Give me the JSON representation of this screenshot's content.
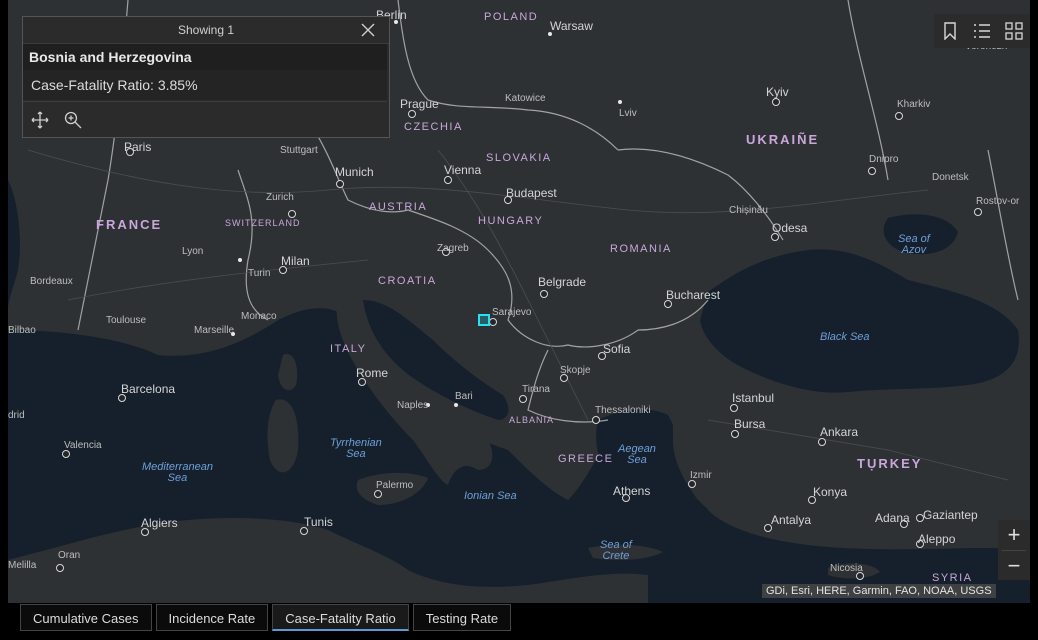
{
  "popup": {
    "header": "Showing 1",
    "title": "Bosnia and Herzegovina",
    "field": "Case-Fatality Ratio: 3.85%"
  },
  "map": {
    "countries": [
      "POLAND",
      "CZECHIA",
      "SLOVAKIA",
      "UKRAINE",
      "AUSTRIA",
      "HUNGARY",
      "FRANCE",
      "SWITZERLAND",
      "ROMANIA",
      "CROATIA",
      "ITALY",
      "ALBANIA",
      "GREECE",
      "TURKEY",
      "SYRIA"
    ],
    "cities": [
      "Berlin",
      "Warsaw",
      "Katowice",
      "Lviv",
      "Kyiv",
      "Kharkiv",
      "Voronezh",
      "Prague",
      "Paris",
      "Stuttgart",
      "Munich",
      "Vienna",
      "Budapest",
      "Dnipro",
      "Donetsk",
      "Rostov-or",
      "Chisinau",
      "Zurich",
      "Lyon",
      "Turin",
      "Milan",
      "Zagreb",
      "Odesa",
      "Bordeaux",
      "Belgrade",
      "Bucharest",
      "Toulouse",
      "Marseille",
      "Monaco",
      "Sarajevo",
      "Bilbao",
      "Sofia",
      "Skopje",
      "Barcelona",
      "Rome",
      "Naples",
      "Bari",
      "Tirana",
      "Istanbul",
      "Thessaloniki",
      "Bursa",
      "Ankara",
      "Madrid",
      "Valencia",
      "Izmir",
      "Athens",
      "Palermo",
      "Konya",
      "Antalya",
      "Adana",
      "Gaziantep",
      "Algiers",
      "Tunis",
      "Aleppo",
      "Oran",
      "Melilla",
      "Nicosia"
    ],
    "seas": [
      "Sea of Azov",
      "Black Sea",
      "Tyrrhenian Sea",
      "Mediterranean Sea",
      "Aegean Sea",
      "Ionian Sea",
      "Sea of Crete"
    ],
    "ukraine_label": "UKRAIÑE",
    "chisinau_label": "Chișinău",
    "turkey_label": "TỤRKEY"
  },
  "attribution": "GDi, Esri, HERE, Garmin, FAO, NOAA, USGS",
  "tabs": [
    "Cumulative Cases",
    "Incidence Rate",
    "Case-Fatality Ratio",
    "Testing Rate"
  ],
  "active_tab": "Case-Fatality Ratio",
  "widgets": [
    "bookmark-icon",
    "legend-list-icon",
    "basemap-gallery-icon"
  ],
  "colors": {
    "land": "#2e3134",
    "water": "#16202c",
    "accent": "#5b9bd5",
    "highlight": "#27e1f0"
  }
}
